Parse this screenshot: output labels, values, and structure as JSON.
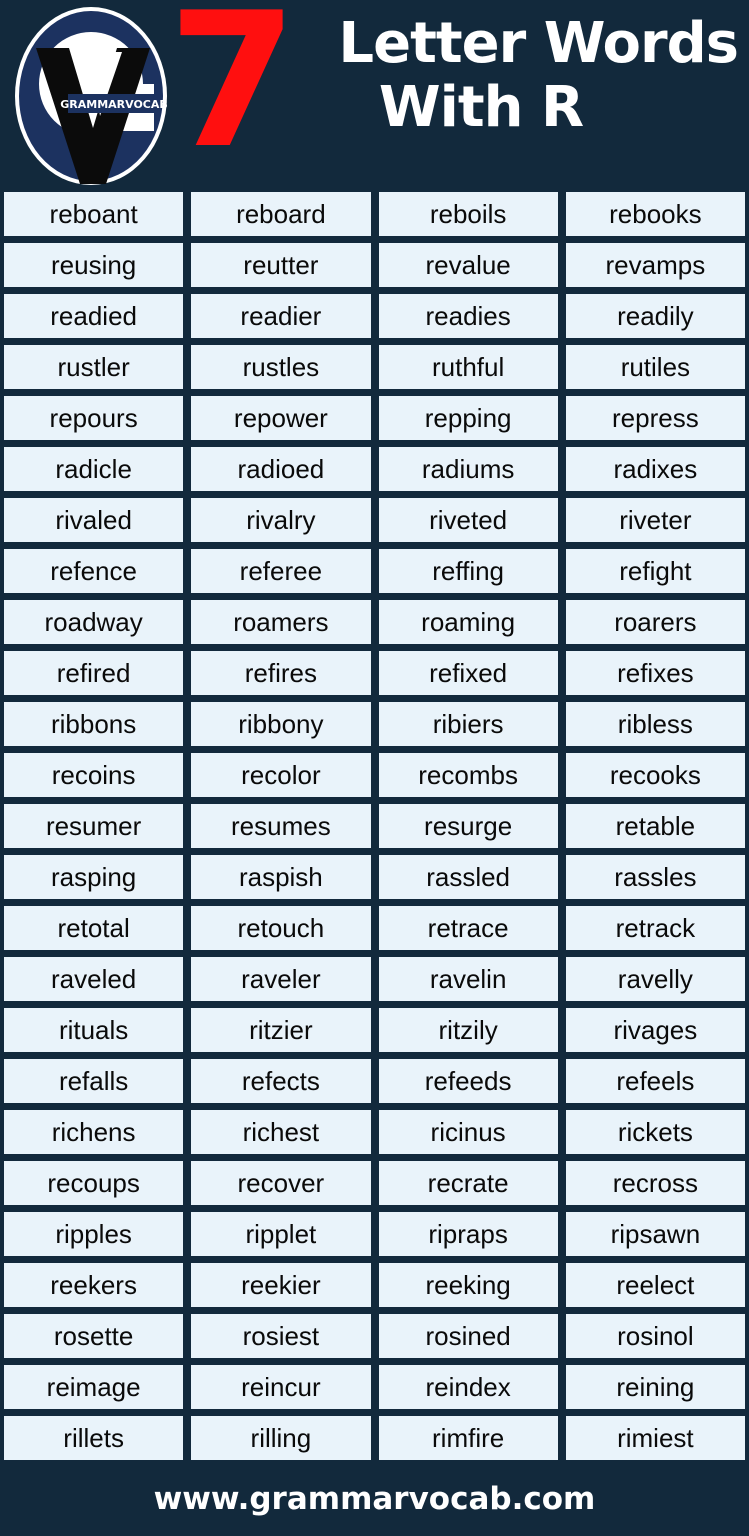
{
  "colors": {
    "background": "#12293c",
    "cell_fill": "#e9f3fa",
    "cell_text": "#0a0a0a",
    "title_text": "#ffffff",
    "accent_red": "#ff0f0f",
    "logo_navy": "#1c3260"
  },
  "header": {
    "number": "7",
    "title_line_1": "Letter Words",
    "title_line_2": "With R",
    "logo": {
      "brand_text": "GRAMMARVOCAB",
      "letter_g": "G",
      "letter_v": "V"
    }
  },
  "grid": {
    "columns": 4,
    "rows": 25,
    "words": [
      [
        "reboant",
        "reboard",
        "reboils",
        "rebooks"
      ],
      [
        "reusing",
        "reutter",
        "revalue",
        "revamps"
      ],
      [
        "readied",
        "readier",
        "readies",
        "readily"
      ],
      [
        "rustler",
        "rustles",
        "ruthful",
        "rutiles"
      ],
      [
        "repours",
        "repower",
        "repping",
        "repress"
      ],
      [
        "radicle",
        "radioed",
        "radiums",
        "radixes"
      ],
      [
        "rivaled",
        "rivalry",
        "riveted",
        "riveter"
      ],
      [
        "refence",
        "referee",
        "reffing",
        "refight"
      ],
      [
        "roadway",
        "roamers",
        "roaming",
        "roarers"
      ],
      [
        "refired",
        "refires",
        "refixed",
        "refixes"
      ],
      [
        "ribbons",
        "ribbony",
        "ribiers",
        "ribless"
      ],
      [
        "recoins",
        "recolor",
        "recombs",
        "recooks"
      ],
      [
        "resumer",
        "resumes",
        "resurge",
        "retable"
      ],
      [
        "rasping",
        "raspish",
        "rassled",
        "rassles"
      ],
      [
        "retotal",
        "retouch",
        "retrace",
        "retrack"
      ],
      [
        "raveled",
        "raveler",
        "ravelin",
        "ravelly"
      ],
      [
        "rituals",
        "ritzier",
        "ritzily",
        "rivages"
      ],
      [
        "refalls",
        "refects",
        "refeeds",
        "refeels"
      ],
      [
        "richens",
        "richest",
        "ricinus",
        "rickets"
      ],
      [
        "recoups",
        "recover",
        "recrate",
        "recross"
      ],
      [
        "ripples",
        "ripplet",
        "ripraps",
        "ripsawn"
      ],
      [
        "reekers",
        "reekier",
        "reeking",
        "reelect"
      ],
      [
        "rosette",
        "rosiest",
        "rosined",
        "rosinol"
      ],
      [
        "reimage",
        "reincur",
        "reindex",
        "reining"
      ],
      [
        "rillets",
        "rilling",
        "rimfire",
        "rimiest"
      ]
    ]
  },
  "footer": {
    "website": "www.grammarvocab.com"
  }
}
